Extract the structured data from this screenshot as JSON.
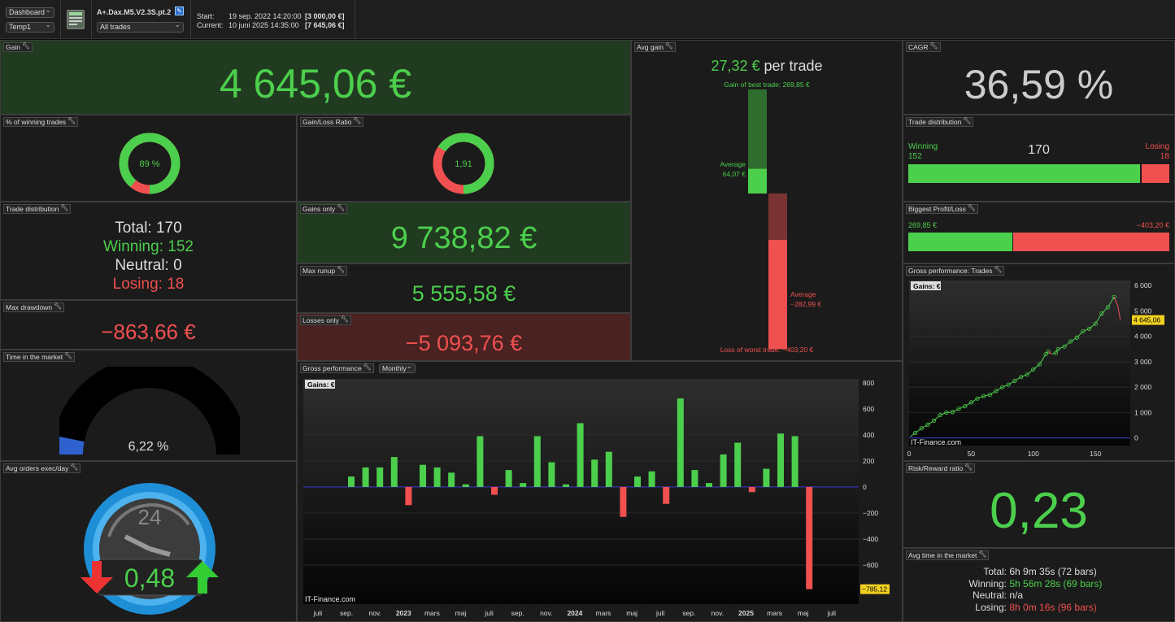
{
  "toolbar": {
    "dashboard_select": "Dashboard",
    "template_select": "Temp1",
    "strategy_name": "A+.Dax.M5.V2.3S.pt.2",
    "trades_filter": "All trades",
    "start_label": "Start:",
    "start_date": "19 sep. 2022 14:20:00",
    "start_value": "[3 000,00 €]",
    "current_label": "Current:",
    "current_date": "10 juni 2025 14:35:00",
    "current_value": "[7 645,06 €]"
  },
  "gain": {
    "title": "Gain",
    "value": "4 645,06 €"
  },
  "winning_pct": {
    "title": "% of winning trades",
    "label": "89 %",
    "fraction": 0.89
  },
  "gain_loss_ratio": {
    "title": "Gain/Loss Ratio",
    "label": "1,91",
    "fraction": 0.656
  },
  "trade_dist_text": {
    "title": "Trade distribution",
    "total": "Total: 170",
    "winning": "Winning: 152",
    "neutral": "Neutral: 0",
    "losing": "Losing: 18"
  },
  "gains_only": {
    "title": "Gains only",
    "value": "9 738,82 €"
  },
  "max_runup": {
    "title": "Max runup",
    "value": "5 555,58 €"
  },
  "max_drawdown": {
    "title": "Max drawdown",
    "value": "−863,66 €"
  },
  "losses_only": {
    "title": "Losses only",
    "value": "−5 093,76 €"
  },
  "time_in_market": {
    "title": "Time in the market",
    "value": "6,22 %",
    "fraction": 0.0622
  },
  "avg_orders": {
    "title": "Avg orders exec/day",
    "value": "0,48",
    "clock_label": "24"
  },
  "avg_gain": {
    "title": "Avg gain",
    "value": "27,32 €",
    "suffix": "per trade",
    "best_label": "Gain of best trade: 269,85 €",
    "avg_gain_label": "Average",
    "avg_gain_value": "64,07 €",
    "avg_loss_label": "Average",
    "avg_loss_value": "−282,99 €",
    "worst_label": "Loss of worst trade: −403,20 €",
    "best": 269.85,
    "avg_win": 64.07,
    "avg_loss": -282.99,
    "worst": -403.2
  },
  "cagr": {
    "title": "CAGR",
    "value": "36,59 %"
  },
  "trade_dist_bar": {
    "title": "Trade distribution",
    "winning_label": "Winning",
    "winning_count": "152",
    "total": "170",
    "losing_label": "Losing",
    "losing_count": "18",
    "win": 152,
    "lose": 18
  },
  "biggest": {
    "title": "Biggest Profit/Loss",
    "profit": "269,85 €",
    "loss": "−403,20 €",
    "profit_value": 269.85,
    "loss_value": -403.2
  },
  "gross_trades": {
    "title": "Gross performance: Trades",
    "series_label": "Gains: €",
    "last_value_tag": "4 645,06",
    "watermark": "IT-Finance.com"
  },
  "gross_monthly": {
    "title": "Gross performance",
    "period_select": "Monthly",
    "series_label": "Gains: €",
    "min_value_tag": "−785,12",
    "watermark": "IT-Finance.com"
  },
  "risk_reward": {
    "title": "Risk/Reward ratio",
    "value": "0,23"
  },
  "avg_time": {
    "title": "Avg time in the market",
    "total_label": "Total:",
    "total_value": "6h 9m 35s (72 bars)",
    "winning_label": "Winning:",
    "winning_value": "5h 56m 28s (69 bars)",
    "neutral_label": "Neutral:",
    "neutral_value": "n/a",
    "losing_label": "Losing:",
    "losing_value": "8h 0m 16s (96 bars)"
  },
  "colors": {
    "green": "#4ccf4c",
    "red": "#f05050",
    "green_bg": "#213b21",
    "red_bg": "#4a2222"
  },
  "chart_data": [
    {
      "type": "bar",
      "title": "Gross performance",
      "series": [
        {
          "name": "Gains: €",
          "values": [
            80,
            150,
            150,
            230,
            -140,
            170,
            150,
            110,
            20,
            390,
            -60,
            130,
            30,
            390,
            190,
            20,
            490,
            210,
            270,
            -230,
            80,
            120,
            -130,
            680,
            130,
            30,
            250,
            340,
            -40,
            140,
            410,
            390,
            -785.12
          ]
        }
      ],
      "categories": [
        "2022-09",
        "2022-10",
        "2022-11",
        "2022-12",
        "2023-01",
        "2023-02",
        "2023-03",
        "2023-04",
        "2023-05",
        "2023-06",
        "2023-07",
        "2023-08",
        "2023-09",
        "2023-10",
        "2023-11",
        "2023-12",
        "2024-01",
        "2024-02",
        "2024-03",
        "2024-04",
        "2024-05",
        "2024-06",
        "2024-07",
        "2024-08",
        "2024-09",
        "2024-10",
        "2024-11",
        "2024-12",
        "2025-01",
        "2025-02",
        "2025-03",
        "2025-04",
        "2025-05"
      ],
      "x_tick_labels": [
        "juli",
        "sep.",
        "nov.",
        "2023",
        "mars",
        "maj",
        "juli",
        "sep.",
        "nov.",
        "2024",
        "mars",
        "maj",
        "juli",
        "sep.",
        "nov.",
        "2025",
        "mars",
        "maj",
        "juli"
      ],
      "y_ticks": [
        800,
        600,
        400,
        200,
        0,
        -200,
        -400,
        -600
      ],
      "y_tick_labels": [
        "800",
        "600",
        "400",
        "200",
        "0",
        "−200",
        "−400",
        "−600"
      ],
      "ylim": [
        -900,
        830
      ]
    },
    {
      "type": "line",
      "title": "Gross performance: Trades",
      "series": [
        {
          "name": "Gains: €",
          "x": [
            1,
            5,
            10,
            15,
            20,
            25,
            30,
            35,
            40,
            45,
            50,
            55,
            60,
            65,
            70,
            75,
            80,
            85,
            90,
            95,
            100,
            105,
            110,
            112,
            115,
            118,
            120,
            125,
            130,
            135,
            140,
            145,
            150,
            155,
            160,
            165,
            168,
            170
          ],
          "y": [
            50,
            200,
            380,
            520,
            680,
            900,
            1000,
            1020,
            1150,
            1250,
            1400,
            1550,
            1650,
            1700,
            1850,
            2000,
            2100,
            2250,
            2400,
            2500,
            2700,
            2900,
            3300,
            3400,
            3300,
            3350,
            3500,
            3600,
            3800,
            3950,
            4200,
            4300,
            4500,
            4900,
            5150,
            5550,
            5200,
            4645.06
          ]
        }
      ],
      "x_ticks": [
        0,
        50,
        100,
        150
      ],
      "y_ticks": [
        0,
        1000,
        2000,
        3000,
        4000,
        5000,
        6000
      ],
      "y_tick_labels": [
        "0",
        "1 000",
        "2 000",
        "3 000",
        "4 000",
        "5 000",
        "6 000"
      ],
      "xlim": [
        0,
        178
      ],
      "ylim": [
        -300,
        6200
      ]
    }
  ]
}
